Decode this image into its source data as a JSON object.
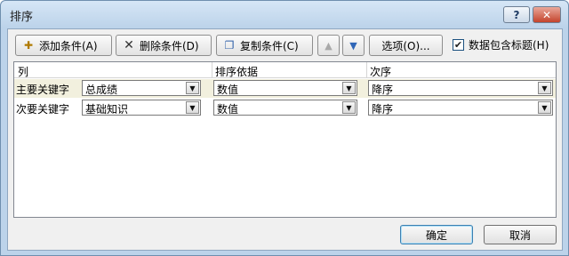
{
  "window": {
    "title": "排序"
  },
  "titlebar_buttons": {
    "help": "?",
    "close": "✕"
  },
  "toolbar": {
    "add_label": "添加条件(A)",
    "delete_label": "删除条件(D)",
    "copy_label": "复制条件(C)",
    "options_label": "选项(O)...",
    "header_checkbox_label": "数据包含标题(H)",
    "header_checkbox_checked": true
  },
  "grid": {
    "columns": [
      "列",
      "排序依据",
      "次序"
    ],
    "rows": [
      {
        "label": "主要关键字",
        "column": "总成绩",
        "sort_on": "数值",
        "order": "降序",
        "selected": true
      },
      {
        "label": "次要关键字",
        "column": "基础知识",
        "sort_on": "数值",
        "order": "降序",
        "selected": false
      }
    ]
  },
  "footer": {
    "ok_label": "确定",
    "cancel_label": "取消"
  },
  "icons": {
    "add": "add-condition-icon",
    "delete": "delete-icon",
    "copy": "copy-icon",
    "move_up": "move-up-icon",
    "move_down": "move-down-icon"
  }
}
